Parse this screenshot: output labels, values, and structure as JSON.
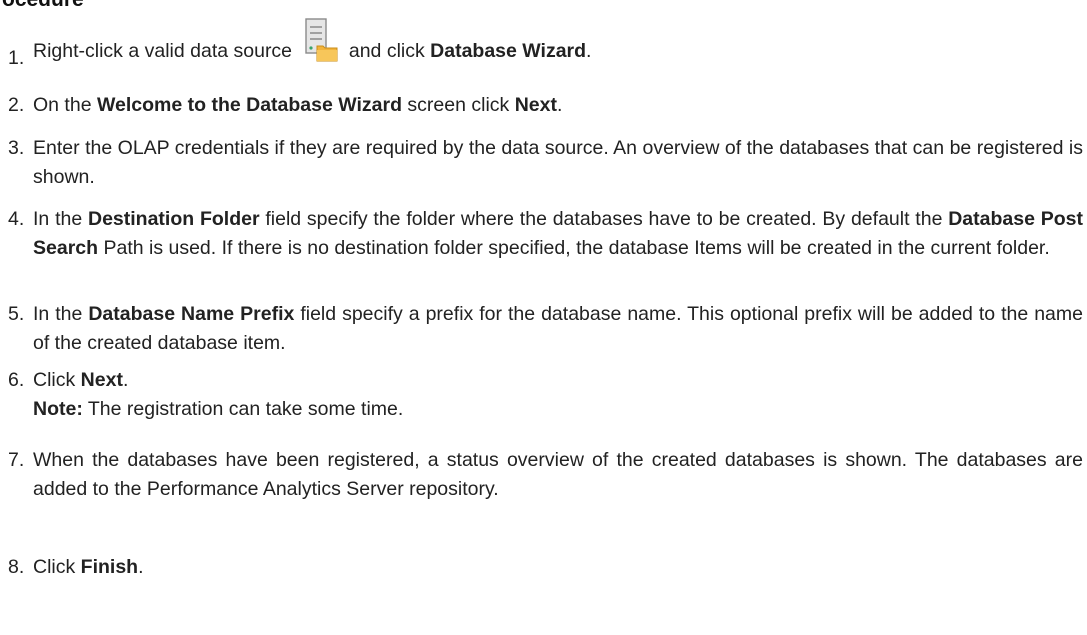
{
  "heading": "ocedure",
  "steps": [
    {
      "num": "1.",
      "parts": [
        {
          "t": "Right-click a valid data source "
        },
        {
          "icon": "database-folder-icon"
        },
        {
          "t": " and click "
        },
        {
          "t": "Database Wizard",
          "b": true
        },
        {
          "t": "."
        }
      ]
    },
    {
      "num": "2.",
      "parts": [
        {
          "t": "On the "
        },
        {
          "t": "Welcome to the Database Wizard",
          "b": true
        },
        {
          "t": " screen click "
        },
        {
          "t": "Next",
          "b": true
        },
        {
          "t": "."
        }
      ]
    },
    {
      "num": "3.",
      "parts": [
        {
          "t": "Enter the OLAP credentials if they are required by the data source. An overview of the databases that can be registered is shown."
        }
      ]
    },
    {
      "num": "4.",
      "parts": [
        {
          "t": "In the "
        },
        {
          "t": "Destination Folder",
          "b": true
        },
        {
          "t": " field specify the folder where the databases have to be created. By default the "
        },
        {
          "t": "Database Post Search",
          "b": true
        },
        {
          "t": " Path is used. If there is no destination folder specified, the database Items will be created in the current folder."
        }
      ]
    },
    {
      "num": "5.",
      "parts": [
        {
          "t": "In the "
        },
        {
          "t": "Database Name Prefix",
          "b": true
        },
        {
          "t": " field specify a prefix for the database name. This optional prefix will be added to the name of the created database item."
        }
      ]
    },
    {
      "num": "6.",
      "parts": [
        {
          "t": "Click "
        },
        {
          "t": "Next",
          "b": true
        },
        {
          "t": "."
        },
        {
          "br": true
        },
        {
          "t": "Note:",
          "b": true
        },
        {
          "t": " The registration can take some time."
        }
      ]
    },
    {
      "num": "7.",
      "parts": [
        {
          "t": "When the databases have been registered, a status overview of the created databases is shown. The databases are added to the Performance Analytics Server repository."
        }
      ]
    },
    {
      "num": "8.",
      "parts": [
        {
          "t": "Click "
        },
        {
          "t": "Finish",
          "b": true
        },
        {
          "t": "."
        }
      ]
    }
  ],
  "colors": {
    "text": "#222222",
    "folder": "#f2b33a",
    "server": "#8a8a8a",
    "server_light": "#e6e6e6"
  }
}
